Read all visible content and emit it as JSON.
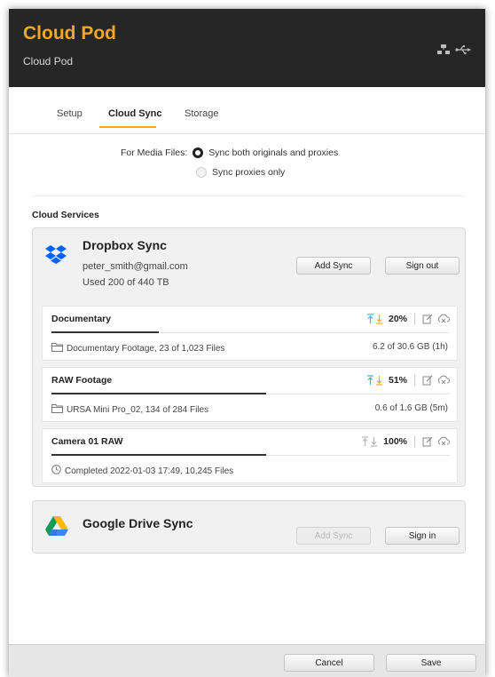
{
  "header": {
    "title": "Cloud Pod",
    "subtitle": "Cloud Pod",
    "icons": [
      "ethernet-icon",
      "usb-icon"
    ]
  },
  "tabs": [
    {
      "label": "Setup",
      "active": false
    },
    {
      "label": "Cloud Sync",
      "active": true
    },
    {
      "label": "Storage",
      "active": false
    }
  ],
  "media": {
    "label": "For Media Files:",
    "options": [
      {
        "label": "Sync both originals and proxies",
        "selected": true
      },
      {
        "label": "Sync proxies only",
        "selected": false
      }
    ]
  },
  "cloud_services": {
    "label": "Cloud Services",
    "dropbox": {
      "title": "Dropbox Sync",
      "email": "peter_smith@gmail.com",
      "usage": "Used 200 of 440 TB",
      "add_sync": "Add Sync",
      "sign_out": "Sign out",
      "icon": "dropbox-icon",
      "syncs": [
        {
          "name": "Documentary",
          "percent": "20%",
          "progress": 0.27,
          "detail": "Documentary Footage,  23 of 1,023 Files",
          "size": "6.2 of 30.6 GB (1h)",
          "detail_icon": "folder-icon",
          "active": true
        },
        {
          "name": "RAW Footage",
          "percent": "51%",
          "progress": 0.54,
          "detail": "URSA Mini Pro_02,  134 of 284 Files",
          "size": "0.6 of 1.6 GB (5m)",
          "detail_icon": "folder-icon",
          "active": true
        },
        {
          "name": "Camera 01 RAW",
          "percent": "100%",
          "progress": 0.54,
          "detail": "Completed 2022-01-03 17:49, 10,245 Files",
          "size": "",
          "detail_icon": "clock-icon",
          "active": false
        }
      ]
    },
    "google": {
      "title": "Google Drive Sync",
      "add_sync": "Add Sync",
      "sign_in": "Sign in",
      "icon": "google-drive-icon"
    }
  },
  "footer": {
    "cancel": "Cancel",
    "save": "Save"
  },
  "colors": {
    "accent": "#f5a623",
    "sync_up": "#2bb8e6",
    "sync_down": "#f5a623",
    "header_bg": "#262626"
  }
}
